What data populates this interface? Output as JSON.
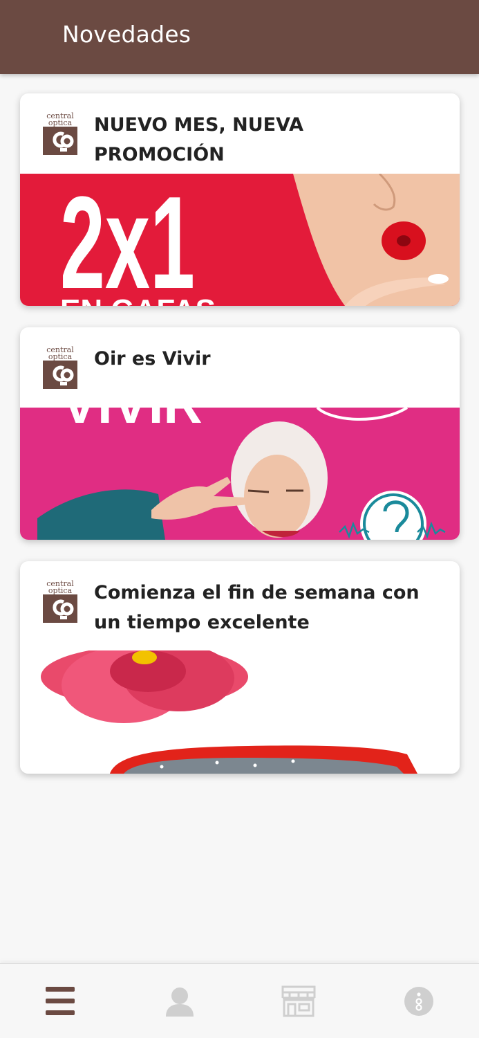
{
  "header": {
    "title": "Novedades"
  },
  "logo": {
    "line1": "central",
    "line2": "optica"
  },
  "posts": [
    {
      "title": "NUEVO MES, NUEVA PROMOCIÓN",
      "image": {
        "headline": "2x1",
        "subline": "EN GAFAS",
        "background": "#e31b3a"
      }
    },
    {
      "title": "Oir es Vivir",
      "image": {
        "headline": "VIVIR",
        "background": "#e02d83"
      }
    },
    {
      "title": "Comienza el fin de semana con un tiempo excelente",
      "image": {
        "background": "#ffffff"
      }
    }
  ],
  "bottom_nav": {
    "items": [
      {
        "icon": "menu-icon",
        "active": true
      },
      {
        "icon": "user-icon",
        "active": false
      },
      {
        "icon": "store-icon",
        "active": false
      },
      {
        "icon": "info-icon",
        "active": false
      }
    ]
  },
  "colors": {
    "brand": "#6b4a42",
    "nav_active": "#6b4a42",
    "nav_inactive": "#cfcfcf"
  }
}
